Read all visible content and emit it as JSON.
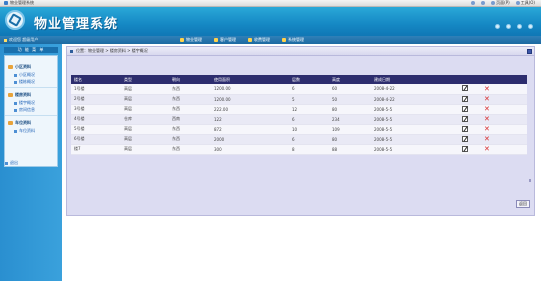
{
  "browser": {
    "tab_title": "物业管理系统",
    "tools": [
      "页面(P)",
      "工具(O)"
    ]
  },
  "app": {
    "title": "物业管理系统"
  },
  "nav": {
    "user_text": "欢迎您 超级用户",
    "items": [
      "物业管理",
      "客户管理",
      "收费管理",
      "系统管理"
    ]
  },
  "sidebar": {
    "header": "功 能 菜 单",
    "groups": [
      {
        "label": "小区资料",
        "links": [
          "小区概况",
          "楼栋概况"
        ]
      },
      {
        "label": "楼房资料",
        "links": [
          "楼宇概况",
          "房间信息"
        ]
      },
      {
        "label": "车位资料",
        "links": [
          "车位资料"
        ]
      }
    ],
    "bottom_link": "退出"
  },
  "main": {
    "breadcrumb": "位置：物业管理 > 楼房资料 > 楼宇概况",
    "return_label": "返回"
  },
  "table": {
    "headers": [
      "楼名",
      "类型",
      "朝向",
      "使用面积",
      "层数",
      "高度",
      "建成日期",
      "",
      ""
    ],
    "rows": [
      [
        "1号楼",
        "高层",
        "东西",
        "1200.00",
        "6",
        "60",
        "2008-4-22"
      ],
      [
        "2号楼",
        "高层",
        "东西",
        "1200.00",
        "5",
        "50",
        "2008-4-22"
      ],
      [
        "3号楼",
        "高层",
        "东西",
        "222.00",
        "12",
        "80",
        "2008-5-5"
      ],
      [
        "4号楼",
        "仓库",
        "西南",
        "122",
        "6",
        "234",
        "2008-5-5"
      ],
      [
        "5号楼",
        "高层",
        "东西",
        "872",
        "10",
        "109",
        "2008-5-5"
      ],
      [
        "6号楼",
        "高层",
        "东西",
        "2000",
        "6",
        "80",
        "2008-5-5"
      ],
      [
        "楼7",
        "高层",
        "东西",
        "300",
        "8",
        "88",
        "2008-5-5"
      ]
    ]
  },
  "icons": {
    "edit": "edit-icon",
    "delete": "delete-icon",
    "delete_color": "#d72b2b"
  }
}
